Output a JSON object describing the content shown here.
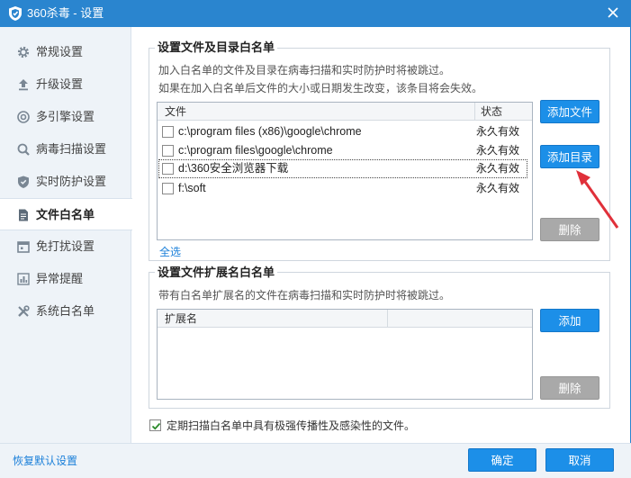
{
  "window": {
    "title": "360杀毒 - 设置"
  },
  "sidebar": {
    "items": [
      {
        "label": "常规设置",
        "icon": "gear-icon"
      },
      {
        "label": "升级设置",
        "icon": "upload-icon"
      },
      {
        "label": "多引擎设置",
        "icon": "engine-icon"
      },
      {
        "label": "病毒扫描设置",
        "icon": "search-icon"
      },
      {
        "label": "实时防护设置",
        "icon": "shield-icon"
      },
      {
        "label": "文件白名单",
        "icon": "document-icon",
        "active": true
      },
      {
        "label": "免打扰设置",
        "icon": "calendar-icon"
      },
      {
        "label": "异常提醒",
        "icon": "bar-chart-icon"
      },
      {
        "label": "系统白名单",
        "icon": "tools-icon"
      }
    ]
  },
  "file_section": {
    "title": "设置文件及目录白名单",
    "desc1": "加入白名单的文件及目录在病毒扫描和实时防护时将被跳过。",
    "desc2": "如果在加入白名单后文件的大小或日期发生改变，该条目将会失效。",
    "columns": {
      "file": "文件",
      "status": "状态"
    },
    "rows": [
      {
        "path": "c:\\program files (x86)\\google\\chrome",
        "status": "永久有效"
      },
      {
        "path": "c:\\program files\\google\\chrome",
        "status": "永久有效"
      },
      {
        "path": "d:\\360安全浏览器下载",
        "status": "永久有效",
        "selected": true
      },
      {
        "path": "f:\\soft",
        "status": "永久有效"
      }
    ],
    "add_file": "添加文件",
    "add_dir": "添加目录",
    "delete": "删除",
    "select_all": "全选"
  },
  "ext_section": {
    "title": "设置文件扩展名白名单",
    "desc": "带有白名单扩展名的文件在病毒扫描和实时防护时将被跳过。",
    "column": "扩展名",
    "add": "添加",
    "delete": "删除"
  },
  "scan_option": {
    "label": "定期扫描白名单中具有极强传播性及感染性的文件。",
    "checked": true
  },
  "footer": {
    "restore": "恢复默认设置",
    "ok": "确定",
    "cancel": "取消"
  },
  "colors": {
    "accent": "#2a85cf",
    "button": "#1c8fe8",
    "arrow": "#e0303a",
    "disabled": "#a9a9a9"
  }
}
